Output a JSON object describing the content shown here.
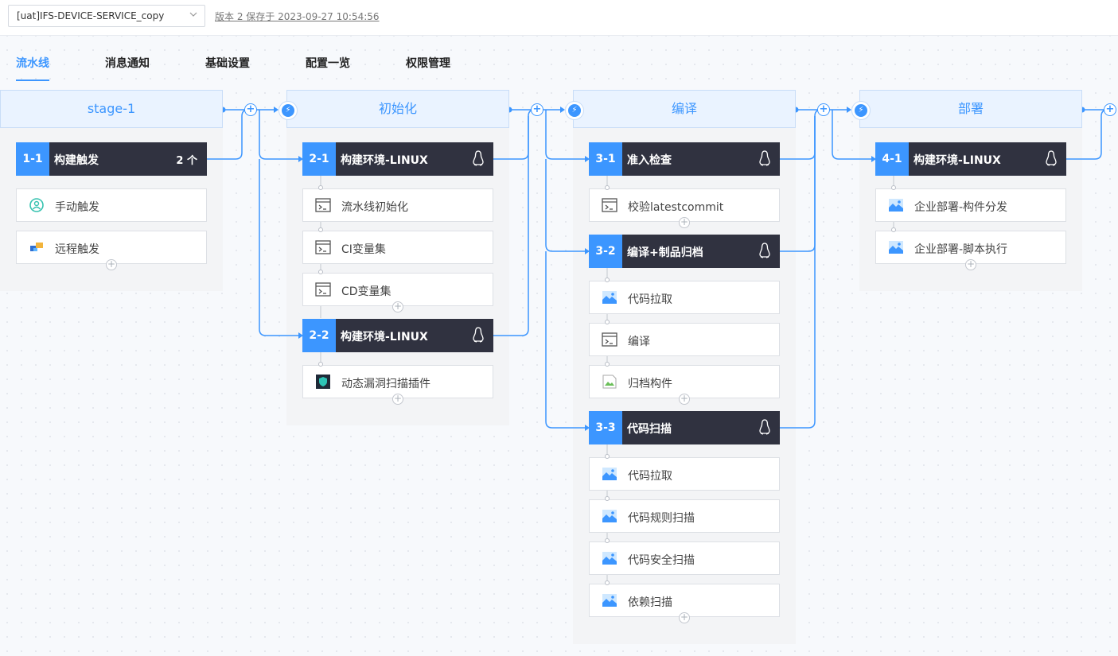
{
  "header": {
    "pipeline_select": "[uat]IFS-DEVICE-SERVICE_copy",
    "version_info": "版本 2 保存于 2023-09-27 10:54:56"
  },
  "tabs": [
    {
      "label": "流水线",
      "active": true
    },
    {
      "label": "消息通知",
      "active": false
    },
    {
      "label": "基础设置",
      "active": false
    },
    {
      "label": "配置一览",
      "active": false
    },
    {
      "label": "权限管理",
      "active": false
    }
  ],
  "colors": {
    "accent": "#3c96ff",
    "job_bg": "#303240",
    "stage_bg": "#eaf3ff"
  },
  "stages": [
    {
      "name": "stage-1",
      "jobs": [
        {
          "num": "1-1",
          "name": "构建触发",
          "badge": "2 个",
          "tasks": [
            {
              "label": "手动触发",
              "icon": "manual-trigger-icon"
            },
            {
              "label": "远程触发",
              "icon": "remote-trigger-icon"
            }
          ]
        }
      ]
    },
    {
      "name": "初始化",
      "jobs": [
        {
          "num": "2-1",
          "name": "构建环境-LINUX",
          "os": "linux-icon",
          "tasks": [
            {
              "label": "流水线初始化",
              "icon": "terminal-icon"
            },
            {
              "label": "CI变量集",
              "icon": "terminal-icon"
            },
            {
              "label": "CD变量集",
              "icon": "terminal-icon"
            }
          ]
        },
        {
          "num": "2-2",
          "name": "构建环境-LINUX",
          "os": "linux-icon",
          "tasks": [
            {
              "label": "动态漏洞扫描插件",
              "icon": "vuln-scan-icon"
            }
          ]
        }
      ]
    },
    {
      "name": "编译",
      "jobs": [
        {
          "num": "3-1",
          "name": "准入检查",
          "os": "linux-icon",
          "tasks": [
            {
              "label": "校验latestcommit",
              "icon": "terminal-icon"
            }
          ]
        },
        {
          "num": "3-2",
          "name": "编译+制品归档",
          "os": "linux-icon",
          "tasks": [
            {
              "label": "代码拉取",
              "icon": "plugin-icon"
            },
            {
              "label": "编译",
              "icon": "terminal-icon"
            },
            {
              "label": "归档构件",
              "icon": "broken-image-icon"
            }
          ]
        },
        {
          "num": "3-3",
          "name": "代码扫描",
          "os": "linux-icon",
          "tasks": [
            {
              "label": "代码拉取",
              "icon": "plugin-icon"
            },
            {
              "label": "代码规则扫描",
              "icon": "plugin-icon"
            },
            {
              "label": "代码安全扫描",
              "icon": "plugin-icon"
            },
            {
              "label": "依赖扫描",
              "icon": "plugin-icon"
            }
          ]
        }
      ]
    },
    {
      "name": "部署",
      "jobs": [
        {
          "num": "4-1",
          "name": "构建环境-LINUX",
          "os": "linux-icon",
          "tasks": [
            {
              "label": "企业部署-构件分发",
              "icon": "plugin-icon"
            },
            {
              "label": "企业部署-脚本执行",
              "icon": "plugin-icon"
            }
          ]
        }
      ]
    }
  ]
}
